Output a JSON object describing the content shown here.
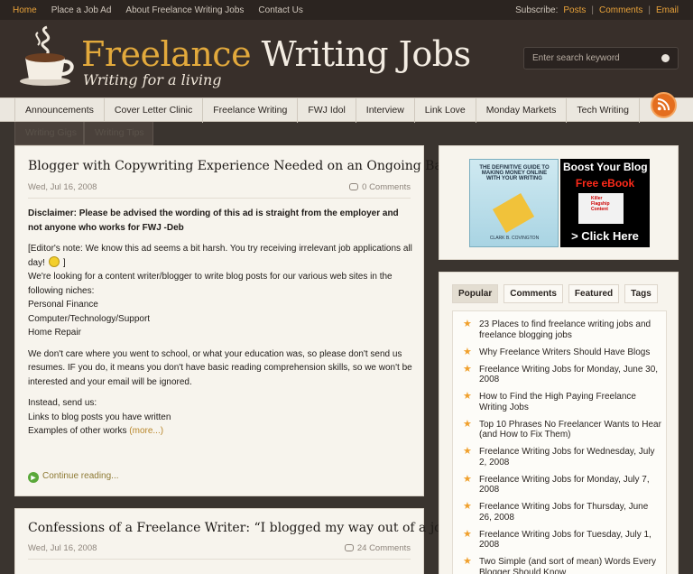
{
  "topbar": {
    "links": [
      "Home",
      "Place a Job Ad",
      "About Freelance Writing Jobs",
      "Contact Us"
    ],
    "subscribe_label": "Subscribe:",
    "subscribe_links": [
      "Posts",
      "Comments",
      "Email"
    ],
    "separator": "|"
  },
  "header": {
    "title_part1": "Freelance",
    "title_part2": "Writing Jobs",
    "tagline": "Writing for a living",
    "search_placeholder": "Enter search keyword"
  },
  "nav": {
    "items": [
      "Announcements",
      "Cover Letter Clinic",
      "Freelance Writing",
      "FWJ Idol",
      "Interview",
      "Link Love",
      "Monday Markets",
      "Tech Writing"
    ],
    "sub_items": [
      "Writing Gigs",
      "Writing Tips"
    ]
  },
  "post1": {
    "title": "Blogger with Copywriting Experience Needed on an Ongoing Basis",
    "date": "Wed, Jul 16, 2008",
    "comments": "0 Comments",
    "disclaimer": "Disclaimer: Please be advised the wording of this ad is straight from the employer and not anyone who works for FWJ -Deb",
    "editor_note_a": "[Editor's note: We know this ad seems a bit harsh. You try receiving irrelevant job applications all day!",
    "editor_note_b": "]",
    "intro": "We're looking for a content writer/blogger to write blog posts for our various web sites in the following niches:",
    "niches": [
      "Personal Finance",
      "Computer/Technology/Support",
      "Home Repair"
    ],
    "requirements": "We don't care where you went to school, or what your education was, so please don't send us resumes. IF you do, it means you don't have basic reading comprehension skills, so we won't be interested and your email will be ignored.",
    "instead": "Instead, send us:",
    "send_items": [
      "Links to blog posts you have written",
      "Examples of other works"
    ],
    "more": "(more...)",
    "continue": "Continue reading..."
  },
  "post2": {
    "title": "Confessions of a Freelance Writer: “I blogged my way out of a job.”",
    "date": "Wed, Jul 16, 2008",
    "comments": "24 Comments"
  },
  "sidebar": {
    "ad_book": {
      "title": "THE DEFINITIVE GUIDE TO MAKING MONEY ONLINE WITH YOUR WRITING",
      "author": "CLARK B. COVINGTON"
    },
    "ad_ebook": {
      "line1": "Boost Your Blog",
      "line2": "Free eBook",
      "book_text": "Killer Flagship Content",
      "line3": "> Click Here"
    },
    "tabs": [
      "Popular",
      "Comments",
      "Featured",
      "Tags"
    ],
    "popular": [
      "23 Places to find freelance writing jobs and freelance blogging jobs",
      "Why Freelance Writers Should Have Blogs",
      "Freelance Writing Jobs for Monday, June 30, 2008",
      "How to Find the High Paying Freelance Writing Jobs",
      "Top 10 Phrases No Freelancer Wants to Hear (and How to Fix Them)",
      "Freelance Writing Jobs for Wednesday, July 2, 2008",
      "Freelance Writing Jobs for Monday, July 7, 2008",
      "Freelance Writing Jobs for Thursday, June 26, 2008",
      "Freelance Writing Jobs for Tuesday, July 1, 2008",
      "Two Simple (and sort of mean) Words Every Blogger Should Know"
    ]
  }
}
